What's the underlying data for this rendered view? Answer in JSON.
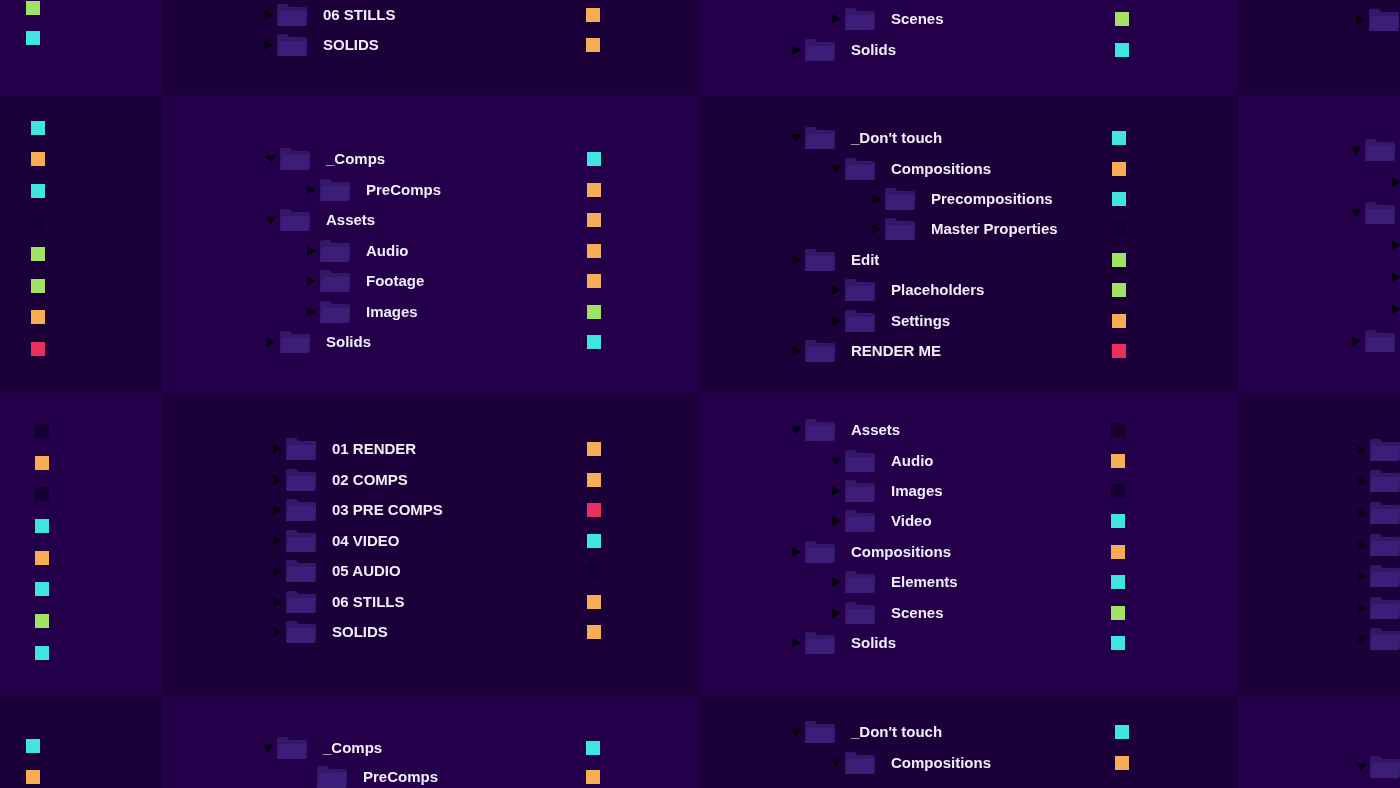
{
  "tile_rows": [
    {
      "tiles": [
        {
          "items": [
            {
              "color": "#a2e263"
            },
            {
              "color": "#3fe6e0"
            }
          ]
        },
        {
          "items": [
            {
              "label": "06 STILLS",
              "expanded": false,
              "color": "#f5ae55"
            },
            {
              "label": "SOLIDS",
              "expanded": false,
              "color": "#f5ae55"
            }
          ]
        },
        {
          "items": [
            {
              "children": [
                {
                  "label": "Scenes",
                  "expanded": false,
                  "color": "#a2e263"
                }
              ]
            },
            {
              "label": "Solids",
              "expanded": false,
              "color": "#3fe6e0"
            }
          ]
        },
        {
          "items": [
            {
              "expanded": false
            }
          ]
        }
      ]
    },
    {
      "tiles": [
        {
          "items": [
            {
              "color": "#3fe6e0"
            },
            {
              "color": "#f5ae55"
            },
            {
              "color": "#3fe6e0"
            },
            {
              "color": "#140030"
            },
            {
              "color": "#a2e263"
            },
            {
              "color": "#a2e263"
            },
            {
              "color": "#f5ae55"
            },
            {
              "color": "#e8305f"
            }
          ]
        },
        {
          "items": [
            {
              "label": "_Comps",
              "expanded": true,
              "color": "#3fe6e0",
              "children": [
                {
                  "label": "PreComps",
                  "expanded": false,
                  "color": "#f5ae55"
                }
              ]
            },
            {
              "label": "Assets",
              "expanded": true,
              "color": "#f5ae55",
              "children": [
                {
                  "label": "Audio",
                  "expanded": false,
                  "color": "#f5ae55"
                },
                {
                  "label": "Footage",
                  "expanded": false,
                  "color": "#f5ae55"
                },
                {
                  "label": "Images",
                  "expanded": false,
                  "color": "#a2e263"
                }
              ]
            },
            {
              "label": "Solids",
              "expanded": false,
              "color": "#3fe6e0"
            }
          ]
        },
        {
          "items": [
            {
              "label": "_Don't touch",
              "expanded": true,
              "color": "#3fe6e0",
              "children": [
                {
                  "label": "Compositions",
                  "expanded": true,
                  "color": "#f5ae55",
                  "children": [
                    {
                      "label": "Precompositions",
                      "expanded": false,
                      "color": "#3fe6e0"
                    },
                    {
                      "label": "Master Properties",
                      "expanded": false,
                      "color": "#140030"
                    }
                  ]
                }
              ]
            },
            {
              "label": "Edit",
              "expanded": false,
              "color": "#a2e263",
              "children": [
                {
                  "label": "Placeholders",
                  "expanded": false,
                  "color": "#a2e263"
                },
                {
                  "label": "Settings",
                  "expanded": false,
                  "color": "#f5ae55"
                }
              ]
            },
            {
              "label": "RENDER ME",
              "expanded": false,
              "color": "#e8305f"
            }
          ]
        },
        {
          "items": [
            {
              "expanded": true,
              "children": [
                {
                  "expanded": false
                }
              ]
            },
            {
              "expanded": true,
              "children": [
                {
                  "expanded": false
                },
                {
                  "expanded": false
                },
                {
                  "expanded": false
                }
              ]
            },
            {
              "expanded": false
            }
          ]
        }
      ]
    },
    {
      "tiles": [
        {
          "items": [
            {
              "color": "#140030"
            },
            {
              "color": "#f5ae55"
            },
            {
              "color": "#140030"
            },
            {
              "color": "#3fe6e0"
            },
            {
              "color": "#f5ae55"
            },
            {
              "color": "#3fe6e0"
            },
            {
              "color": "#a2e263"
            },
            {
              "color": "#3fe6e0"
            }
          ]
        },
        {
          "items": [
            {
              "label": "01 RENDER",
              "expanded": false,
              "color": "#f5ae55"
            },
            {
              "label": "02 COMPS",
              "expanded": false,
              "color": "#f5ae55"
            },
            {
              "label": "03 PRE COMPS",
              "expanded": false,
              "color": "#e8305f"
            },
            {
              "label": "04 VIDEO",
              "expanded": false,
              "color": "#3fe6e0"
            },
            {
              "label": "05 AUDIO",
              "expanded": false,
              "color": "#140030"
            },
            {
              "label": "06 STILLS",
              "expanded": false,
              "color": "#f5ae55"
            },
            {
              "label": "SOLIDS",
              "expanded": false,
              "color": "#f5ae55"
            }
          ]
        },
        {
          "items": [
            {
              "label": "Assets",
              "expanded": true,
              "color": "#140030",
              "children": [
                {
                  "label": "Audio",
                  "expanded": true,
                  "color": "#f5ae55"
                },
                {
                  "label": "Images",
                  "expanded": false,
                  "color": "#140030"
                },
                {
                  "label": "Video",
                  "expanded": false,
                  "color": "#3fe6e0"
                }
              ]
            },
            {
              "label": "Compositions",
              "expanded": false,
              "color": "#f5ae55",
              "children": [
                {
                  "label": "Elements",
                  "expanded": false,
                  "color": "#3fe6e0"
                },
                {
                  "label": "Scenes",
                  "expanded": false,
                  "color": "#a2e263"
                }
              ]
            },
            {
              "label": "Solids",
              "expanded": false,
              "color": "#3fe6e0"
            }
          ]
        },
        {
          "items": [
            {
              "expanded": false
            },
            {
              "expanded": false
            },
            {
              "expanded": false
            },
            {
              "expanded": false
            },
            {
              "expanded": false
            },
            {
              "expanded": false
            },
            {
              "expanded": false
            }
          ]
        }
      ]
    },
    {
      "tiles": [
        {
          "items": [
            {
              "color": "#3fe6e0"
            },
            {
              "color": "#f5ae55"
            }
          ]
        },
        {
          "items": [
            {
              "label": "_Comps",
              "expanded": true,
              "color": "#3fe6e0",
              "children": [
                {
                  "label": "PreComps",
                  "color": "#f5ae55"
                }
              ]
            }
          ]
        },
        {
          "items": [
            {
              "label": "_Don't touch",
              "expanded": true,
              "color": "#3fe6e0",
              "children": [
                {
                  "label": "Compositions",
                  "expanded": true,
                  "color": "#f5ae55"
                }
              ]
            }
          ]
        },
        {
          "items": [
            {
              "expanded": true
            }
          ]
        }
      ]
    }
  ]
}
